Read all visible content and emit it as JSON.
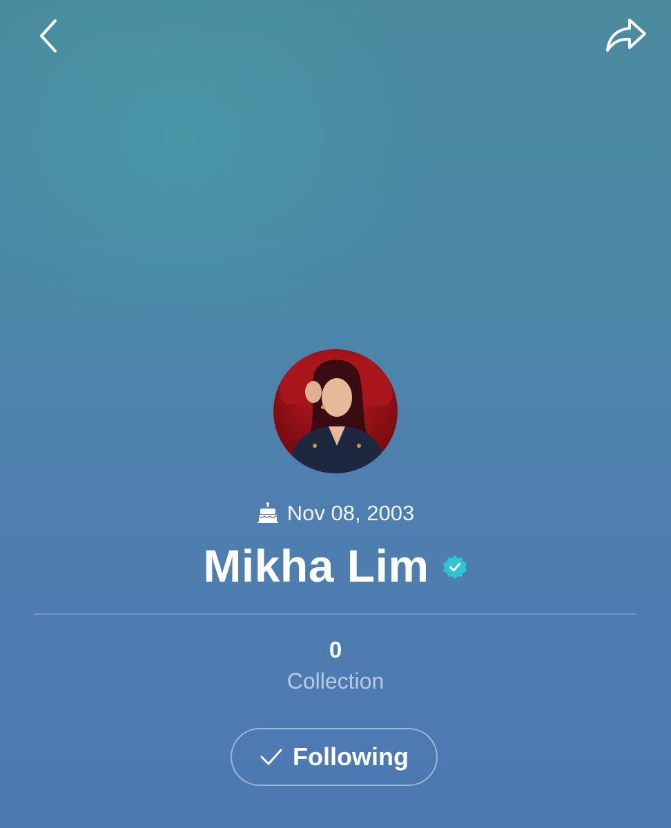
{
  "header": {
    "back_icon": "chevron-left-icon",
    "share_icon": "share-arrow-icon"
  },
  "profile": {
    "avatar_icon": "profile-photo",
    "birthday_icon": "birthday-cake-icon",
    "birthday": "Nov 08, 2003",
    "name": "Mikha Lim",
    "verified_icon": "verified-badge-icon",
    "verified_color": "#2ec4d6"
  },
  "stats": {
    "collection_count": "0",
    "collection_label": "Collection"
  },
  "follow_button": {
    "icon": "checkmark-icon",
    "label": "Following"
  }
}
